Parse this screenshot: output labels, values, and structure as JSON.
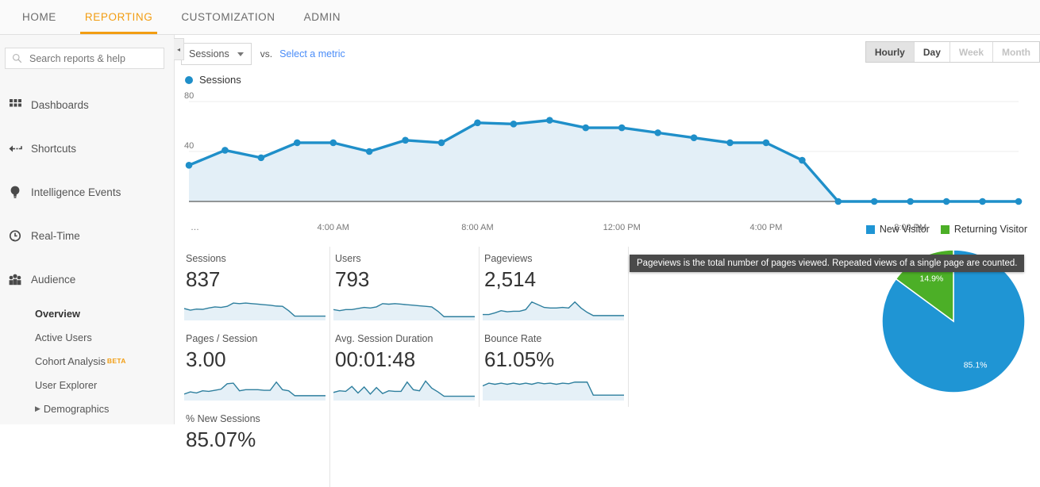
{
  "topnav": {
    "items": [
      {
        "label": "HOME",
        "active": false
      },
      {
        "label": "REPORTING",
        "active": true
      },
      {
        "label": "CUSTOMIZATION",
        "active": false
      },
      {
        "label": "ADMIN",
        "active": false
      }
    ],
    "accent_color": "#f29d12"
  },
  "sidebar": {
    "search_placeholder": "Search reports & help",
    "search_value": "",
    "items": [
      {
        "label": "Dashboards",
        "icon": "grid-icon"
      },
      {
        "label": "Shortcuts",
        "icon": "arrow-shortcut-icon"
      },
      {
        "label": "Intelligence Events",
        "icon": "lightbulb-icon"
      },
      {
        "label": "Real-Time",
        "icon": "clock-icon"
      },
      {
        "label": "Audience",
        "icon": "people-icon"
      }
    ],
    "audience_subitems": [
      {
        "label": "Overview",
        "current": true,
        "badge": "",
        "expandable": false
      },
      {
        "label": "Active Users",
        "current": false,
        "badge": "",
        "expandable": false
      },
      {
        "label": "Cohort Analysis",
        "current": false,
        "badge": "BETA",
        "expandable": false
      },
      {
        "label": "User Explorer",
        "current": false,
        "badge": "",
        "expandable": false
      },
      {
        "label": "Demographics",
        "current": false,
        "badge": "",
        "expandable": true
      }
    ],
    "collapse_icon": "◂"
  },
  "toolbar": {
    "metric_selected": "Sessions",
    "vs_label": "vs.",
    "select_metric_link": "Select a metric",
    "range_buttons": [
      {
        "label": "Hourly",
        "state": "pressed"
      },
      {
        "label": "Day",
        "state": "active"
      },
      {
        "label": "Week",
        "state": "disabled"
      },
      {
        "label": "Month",
        "state": "disabled"
      }
    ]
  },
  "chart_data": {
    "type": "line",
    "title": "",
    "legend": [
      "Sessions"
    ],
    "legend_position": "top-left",
    "xlabel": "",
    "ylabel": "",
    "ylim": [
      0,
      80
    ],
    "yticks": [
      40,
      80
    ],
    "grid": true,
    "line_color": "#1f8fc9",
    "fill_color": "#e3eff7",
    "x_tick_labels": [
      "…",
      "4:00 AM",
      "8:00 AM",
      "12:00 PM",
      "4:00 PM",
      "8:00 PM"
    ],
    "x": [
      "12:00 AM",
      "1:00 AM",
      "2:00 AM",
      "3:00 AM",
      "4:00 AM",
      "5:00 AM",
      "6:00 AM",
      "7:00 AM",
      "8:00 AM",
      "9:00 AM",
      "10:00 AM",
      "11:00 AM",
      "12:00 PM",
      "1:00 PM",
      "2:00 PM",
      "3:00 PM",
      "4:00 PM",
      "5:00 PM",
      "6:00 PM",
      "7:00 PM",
      "8:00 PM",
      "9:00 PM",
      "10:00 PM",
      "11:00 PM"
    ],
    "values": [
      29,
      41,
      35,
      47,
      47,
      40,
      49,
      47,
      63,
      62,
      65,
      59,
      59,
      55,
      51,
      47,
      47,
      33,
      0,
      0,
      0,
      0,
      0,
      0
    ]
  },
  "pie_chart": {
    "type": "pie",
    "title": "",
    "legend": [
      "New Visitor",
      "Returning Visitor"
    ],
    "legend_position": "top",
    "labels": [
      "New Visitor",
      "Returning Visitor"
    ],
    "values": [
      85.1,
      14.9
    ],
    "value_labels": [
      "85.1%",
      "14.9%"
    ],
    "colors": [
      "#1f95d4",
      "#4caf27"
    ]
  },
  "cards": [
    {
      "title": "Sessions",
      "value": "837",
      "spark": [
        38,
        32,
        36,
        35,
        40,
        44,
        42,
        46,
        58,
        56,
        58,
        56,
        54,
        52,
        50,
        47,
        46,
        30,
        10,
        10,
        10,
        10,
        10,
        10
      ]
    },
    {
      "title": "Users",
      "value": "793",
      "spark": [
        34,
        30,
        34,
        34,
        38,
        42,
        40,
        44,
        56,
        54,
        56,
        54,
        52,
        50,
        48,
        46,
        44,
        28,
        8,
        8,
        8,
        8,
        8,
        8
      ]
    },
    {
      "title": "Pageviews",
      "value": "2,514",
      "spark": [
        16,
        16,
        22,
        30,
        26,
        28,
        28,
        34,
        62,
        52,
        42,
        40,
        40,
        42,
        40,
        62,
        40,
        24,
        12,
        12,
        12,
        12,
        12,
        12
      ]
    },
    {
      "title": "Pages / Session",
      "value": "3.00",
      "spark": [
        18,
        26,
        22,
        30,
        28,
        32,
        36,
        56,
        58,
        30,
        34,
        34,
        34,
        32,
        32,
        62,
        34,
        30,
        12,
        12,
        12,
        12,
        12,
        12
      ]
    },
    {
      "title": "Avg. Session Duration",
      "value": "00:01:48",
      "spark": [
        24,
        30,
        28,
        46,
        22,
        44,
        18,
        42,
        20,
        30,
        28,
        28,
        62,
        34,
        30,
        66,
        40,
        26,
        10,
        10,
        10,
        10,
        10,
        10
      ]
    },
    {
      "title": "Bounce Rate",
      "value": "61.05%",
      "spark": [
        48,
        58,
        54,
        58,
        54,
        58,
        54,
        58,
        54,
        60,
        56,
        58,
        54,
        58,
        56,
        62,
        62,
        62,
        14,
        14,
        14,
        14,
        14,
        14
      ]
    },
    {
      "title": "% New Sessions",
      "value": "85.07%",
      "spark": []
    }
  ],
  "tooltip": {
    "text": "Pageviews is the total number of pages viewed. Repeated views of a single page are counted."
  }
}
